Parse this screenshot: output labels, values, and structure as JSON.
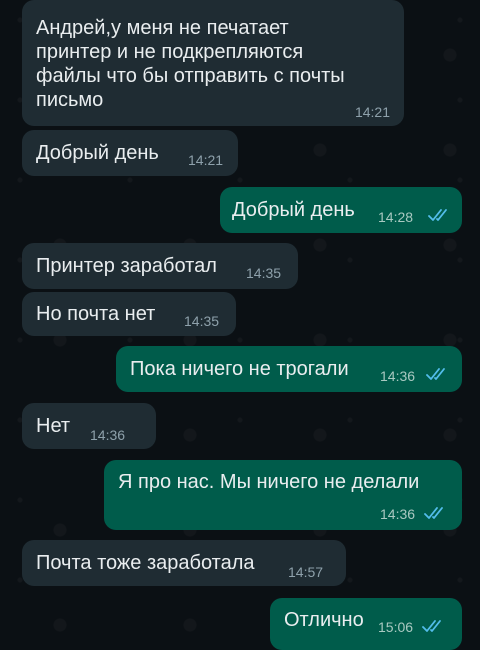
{
  "messages": [
    {
      "direction": "incoming",
      "text": "Андрей,у меня не печатает\nпринтер и не подкрепляются\nфайлы что бы отправить с почты\nписьмо",
      "time": "14:21"
    },
    {
      "direction": "incoming",
      "text": "Добрый день",
      "time": "14:21"
    },
    {
      "direction": "outgoing",
      "text": "Добрый день",
      "time": "14:28",
      "status": "read"
    },
    {
      "direction": "incoming",
      "text": "Принтер заработал",
      "time": "14:35"
    },
    {
      "direction": "incoming",
      "text": "Но почта нет",
      "time": "14:35"
    },
    {
      "direction": "outgoing",
      "text": "Пока ничего не трогали",
      "time": "14:36",
      "status": "read"
    },
    {
      "direction": "incoming",
      "text": "Нет",
      "time": "14:36"
    },
    {
      "direction": "outgoing",
      "text": "Я про нас. Мы ничего не делали",
      "time": "14:36",
      "status": "read"
    },
    {
      "direction": "incoming",
      "text": "Почта тоже заработала",
      "time": "14:57"
    },
    {
      "direction": "outgoing",
      "text": "Отлично",
      "time": "15:06",
      "status": "read"
    }
  ],
  "colors": {
    "background": "#0b1014",
    "incoming_bubble": "#1f2c33",
    "outgoing_bubble": "#005c4b",
    "read_ticks": "#53bdeb"
  }
}
